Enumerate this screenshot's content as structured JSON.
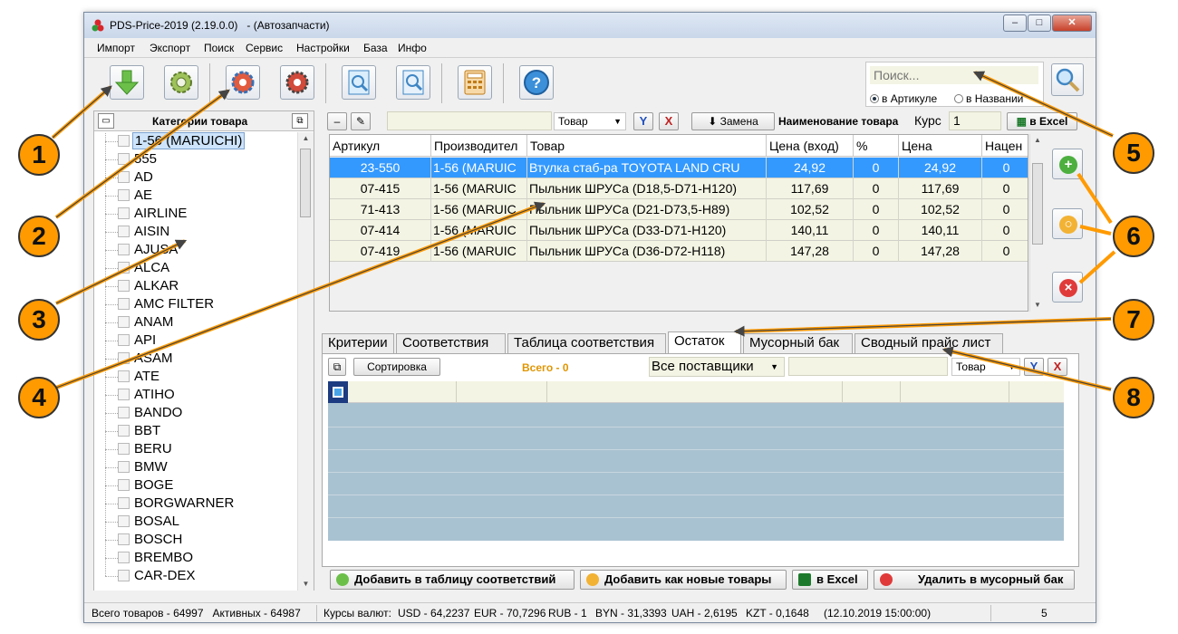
{
  "window": {
    "title": "PDS-Price-2019 (2.19.0.0)   - (Автозапчасти)",
    "minimize": "–",
    "maximize": "□",
    "close": "✕"
  },
  "menu": [
    "Импорт",
    "Экспорт",
    "Поиск",
    "Сервис",
    "Настройки",
    "База",
    "Инфо"
  ],
  "search": {
    "placeholder": "Поиск...",
    "radio_article": "в Артикуле",
    "radio_name": "в Названии",
    "selected": "article"
  },
  "categories": {
    "title": "Категории товара",
    "items": [
      "1-56 (MARUICHI)",
      "555",
      "AD",
      "AE",
      "AIRLINE",
      "AISIN",
      "AJUSA",
      "ALCA",
      "ALKAR",
      "AMC FILTER",
      "ANAM",
      "API",
      "ASAM",
      "ATE",
      "ATIHO",
      "BANDO",
      "BBT",
      "BERU",
      "BMW",
      "BOGE",
      "BORGWARNER",
      "BOSAL",
      "BOSCH",
      "BREMBO",
      "CAR-DEX"
    ],
    "selected_index": 0
  },
  "goods_toolbar": {
    "minus": "–",
    "field_combo": "Товар",
    "replace_button": "Замена",
    "name_label": "Наименование товара",
    "rate_label": "Курс",
    "rate_value": "1",
    "excel_button": "в Excel"
  },
  "goods_table": {
    "columns": [
      "Артикул",
      "Производител",
      "Товар",
      "Цена (вход)",
      "%",
      "Цена",
      "Нацен"
    ],
    "rows": [
      [
        "23-550",
        "1-56 (MARUIC",
        "Втулка стаб-ра TOYOTA LAND CRU",
        "24,92",
        "0",
        "24,92",
        "0"
      ],
      [
        "07-415",
        "1-56 (MARUIC",
        "Пыльник ШРУСа (D18,5-D71-H120)",
        "117,69",
        "0",
        "117,69",
        "0"
      ],
      [
        "71-413",
        "1-56 (MARUIC",
        "Пыльник ШРУСа (D21-D73,5-H89)",
        "102,52",
        "0",
        "102,52",
        "0"
      ],
      [
        "07-414",
        "1-56 (MARUIC",
        "Пыльник ШРУСа (D33-D71-H120)",
        "140,11",
        "0",
        "140,11",
        "0"
      ],
      [
        "07-419",
        "1-56 (MARUIC",
        "Пыльник ШРУСа (D36-D72-H118)",
        "147,28",
        "0",
        "147,28",
        "0"
      ]
    ],
    "selected_row": 0
  },
  "tabs": {
    "items": [
      "Критерии",
      "Соответствия",
      "Таблица соответствия",
      "Остаток",
      "Мусорный бак",
      "Сводный прайс лист"
    ],
    "active": 3
  },
  "lower": {
    "sort_button": "Сортировка",
    "total": "Всего - 0",
    "suppliers": "Все поставщики",
    "field_combo": "Товар",
    "buttons": {
      "add_match": "Добавить в таблицу соответствий",
      "add_new": "Добавить как новые товары",
      "excel": "в Excel",
      "trash": "Удалить в мусорный бак"
    }
  },
  "status": {
    "total": "Всего товаров - 64997   Активных - 64987",
    "rates_label": "Курсы валют:",
    "usd": "USD - 64,2237",
    "eur": "EUR - 70,7296",
    "rub": "RUB - 1",
    "byn": "BYN - 31,3393",
    "uah": "UAH - 2,6195",
    "kzt": "KZT - 0,1648",
    "date": "(12.10.2019 15:00:00)",
    "page": "5"
  },
  "callouts": [
    "1",
    "2",
    "3",
    "4",
    "5",
    "6",
    "7",
    "8"
  ],
  "colors": {
    "callout": "#ff9a00",
    "arrow": "#ff9a00",
    "selection": "#3399ff",
    "grid_row": "#f4f4e4",
    "lower_grid": "#a9c2d1"
  }
}
